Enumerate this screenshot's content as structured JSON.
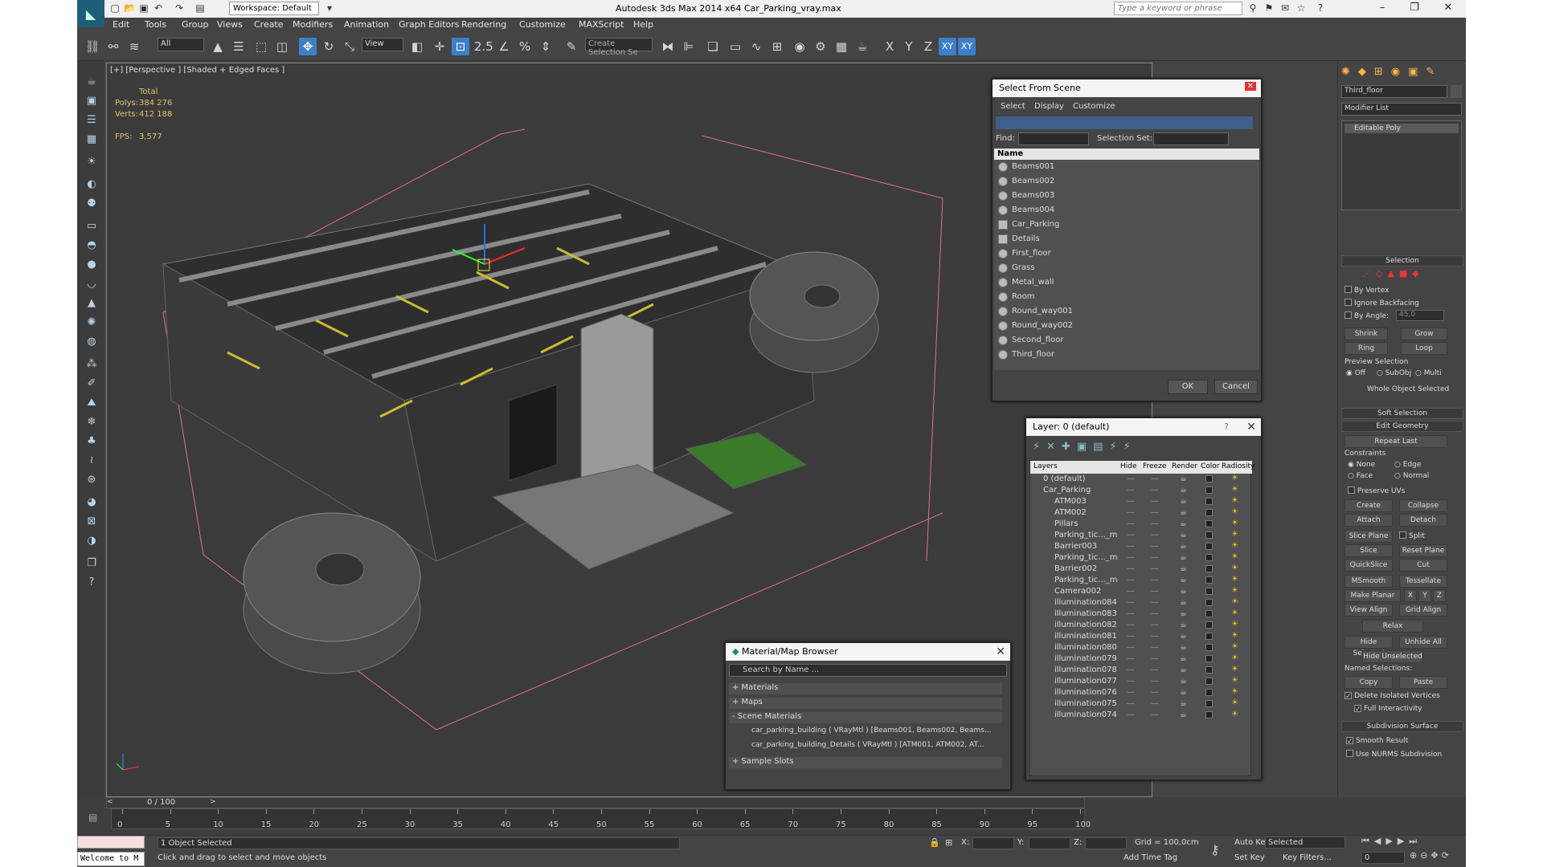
{
  "title": "Autodesk 3ds Max  2014 x64     Car_Parking_vray.max",
  "workspace": "Workspace: Default",
  "search_placeholder": "Type a keyword or phrase",
  "menus": [
    "Edit",
    "Tools",
    "Group",
    "Views",
    "Create",
    "Modifiers",
    "Animation",
    "Graph Editors",
    "Rendering",
    "Customize",
    "MAXScript",
    "Help"
  ],
  "toolbar": {
    "filter": "All",
    "refcoord": "View",
    "selset": "Create Selection Se",
    "axis": [
      "X",
      "Y",
      "Z",
      "XY",
      "XY"
    ],
    "snap_num": "2.5"
  },
  "viewport": {
    "label": "[+] [Perspective ] [Shaded + Edged Faces ]",
    "stats": {
      "total": "Total",
      "polys_label": "Polys:",
      "polys": "384 276",
      "verts_label": "Verts:",
      "verts": "412 188",
      "fps_label": "FPS:",
      "fps": "3,577"
    }
  },
  "select_scene": {
    "title": "Select From Scene",
    "menus": [
      "Select",
      "Display",
      "Customize"
    ],
    "find_label": "Find:",
    "selset_label": "Selection Set:",
    "col_name": "Name",
    "items": [
      "Beams001",
      "Beams002",
      "Beams003",
      "Beams004",
      "Car_Parking",
      "Details",
      "First_floor",
      "Grass",
      "Metal_wall",
      "Room",
      "Round_way001",
      "Round_way002",
      "Second_floor",
      "Third_floor"
    ],
    "ok": "OK",
    "cancel": "Cancel"
  },
  "layer": {
    "title": "Layer: 0 (default)",
    "help": "?",
    "cols": [
      "Layers",
      "Hide",
      "Freeze",
      "Render",
      "Color",
      "Radiosity"
    ],
    "rows": [
      "0 (default)",
      "Car_Parking",
      "ATM003",
      "ATM002",
      "Pillars",
      "Parking_tic..._m",
      "Barrier003",
      "Parking_tic..._m",
      "Barrier002",
      "Parking_tic..._m",
      "Camera002",
      "illumination084",
      "illumination083",
      "illumination082",
      "illumination081",
      "illumination080",
      "illumination079",
      "illumination078",
      "illumination077",
      "illumination076",
      "illumination075",
      "illumination074"
    ]
  },
  "material": {
    "title": "Material/Map Browser",
    "search": "Search by Name ...",
    "sections": [
      "+ Materials",
      "+ Maps",
      "- Scene Materials"
    ],
    "scene": [
      "car_parking_building  ( VRayMtl ) [Beams001, Beams002, Beams...",
      "car_parking_building_Details  ( VRayMtl ) [ATM001, ATM002, AT..."
    ],
    "sample": "+ Sample Slots"
  },
  "panel": {
    "object": "Third_floor",
    "modlist": "Modifier List",
    "stack": "Editable Poly",
    "selection": "Selection",
    "by_vertex": "By Vertex",
    "ignore_bf": "Ignore Backfacing",
    "by_angle": "By Angle:",
    "angle": "45,0",
    "shrink": "Shrink",
    "grow": "Grow",
    "ring": "Ring",
    "loop": "Loop",
    "preview": "Preview Selection",
    "prev_opts": [
      "Off",
      "SubObj",
      "Multi"
    ],
    "whole": "Whole Object Selected",
    "soft": "Soft Selection",
    "edit_geo": "Edit Geometry",
    "repeat": "Repeat Last",
    "constraints": "Constraints",
    "c_opts": [
      "None",
      "Edge",
      "Face",
      "Normal"
    ],
    "preserve": "Preserve UVs",
    "create": "Create",
    "collapse": "Collapse",
    "attach": "Attach",
    "detach": "Detach",
    "slice_plane": "Slice Plane",
    "split": "Split",
    "slice": "Slice",
    "reset_plane": "Reset Plane",
    "quickslice": "QuickSlice",
    "cut": "Cut",
    "msmooth": "MSmooth",
    "tessellate": "Tessellate",
    "make_planar": "Make Planar",
    "xyz": [
      "X",
      "Y",
      "Z"
    ],
    "view_align": "View Align",
    "grid_align": "Grid Align",
    "relax": "Relax",
    "hide_sel": "Hide Selected",
    "unhide_all": "Unhide All",
    "hide_unsel": "Hide Unselected",
    "named_sel": "Named Selections:",
    "copy": "Copy",
    "paste": "Paste",
    "del_iso": "Delete Isolated Vertices",
    "full_inter": "Full Interactivity",
    "subdiv": "Subdivision Surface",
    "smooth": "Smooth Result",
    "nurms": "Use NURMS Subdivision"
  },
  "timeline": {
    "frame": "0 / 100",
    "ticks": [
      "0",
      "5",
      "10",
      "15",
      "20",
      "25",
      "30",
      "35",
      "40",
      "45",
      "50",
      "55",
      "60",
      "65",
      "70",
      "75",
      "80",
      "85",
      "90",
      "95",
      "100"
    ]
  },
  "status": {
    "welcome": "Welcome to M",
    "selected": "1 Object Selected",
    "hint": "Click and drag to select and move objects",
    "x": "X:",
    "y": "Y:",
    "z": "Z:",
    "grid": "Grid = 100,0cm",
    "autokey": "Auto Key",
    "selected_dd": "Selected",
    "setkey": "Set Key",
    "keyfilters": "Key Filters...",
    "addtag": "Add Time Tag",
    "frame": "0"
  }
}
